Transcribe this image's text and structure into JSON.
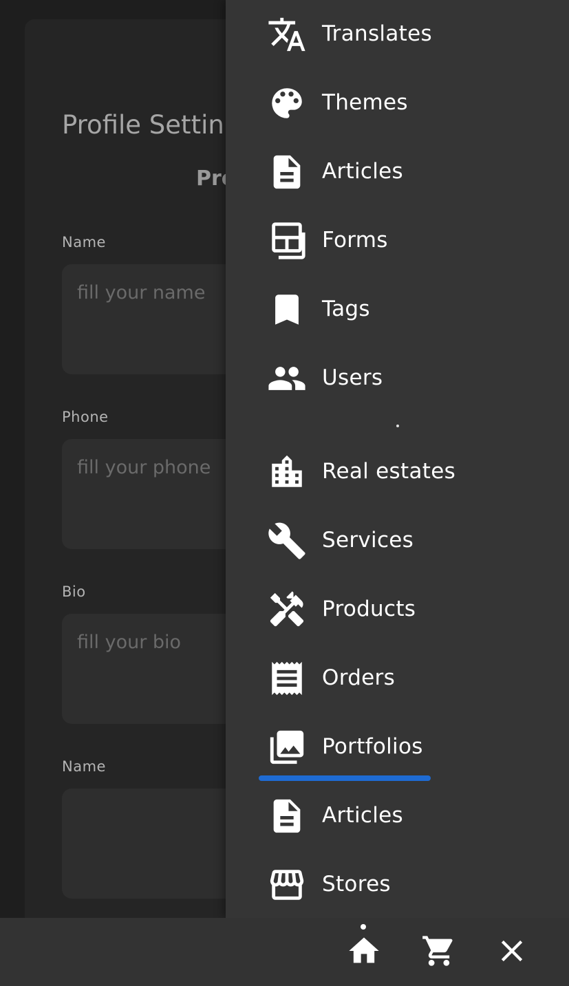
{
  "profile": {
    "title": "Profile Settin",
    "subtitle": "Pro",
    "fields": [
      {
        "label": "Name",
        "placeholder": "fill your name"
      },
      {
        "label": "Phone",
        "placeholder": "fill your phone"
      },
      {
        "label": "Bio",
        "placeholder": "fill your bio"
      },
      {
        "label": "Name",
        "placeholder": ""
      }
    ]
  },
  "menu": {
    "items": [
      {
        "label": "Translates",
        "icon": "translate-icon"
      },
      {
        "label": "Themes",
        "icon": "palette-icon"
      },
      {
        "label": "Articles",
        "icon": "article-icon"
      },
      {
        "label": "Forms",
        "icon": "forms-icon"
      },
      {
        "label": "Tags",
        "icon": "bookmark-icon"
      },
      {
        "label": "Users",
        "icon": "users-icon"
      },
      {
        "label": "Real estates",
        "icon": "building-icon"
      },
      {
        "label": "Services",
        "icon": "wrench-icon"
      },
      {
        "label": "Products",
        "icon": "tools-icon"
      },
      {
        "label": "Orders",
        "icon": "receipt-icon"
      },
      {
        "label": "Portfolios",
        "icon": "photo-library-icon"
      },
      {
        "label": "Articles",
        "icon": "article-icon"
      },
      {
        "label": "Stores",
        "icon": "storefront-icon"
      }
    ],
    "active": "Portfolios"
  },
  "bottom_nav": {
    "items": [
      {
        "icon": "home-icon"
      },
      {
        "icon": "cart-icon"
      },
      {
        "icon": "close-icon"
      }
    ]
  },
  "colors": {
    "drawer_bg": "#353535",
    "accent_underline": "#1e6fdc"
  }
}
